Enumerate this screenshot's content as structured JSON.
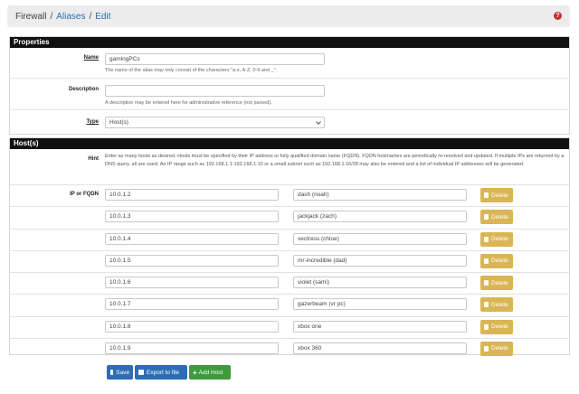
{
  "breadcrumb": {
    "root": "Firewall",
    "aliases": "Aliases",
    "current": "Edit",
    "help_icon": "?"
  },
  "properties": {
    "heading": "Properties",
    "name_label": "Name",
    "name_value": "gamingPCs",
    "name_help": "The name of the alias may only consist of the characters \"a-z, A-Z, 0-9 and _\".",
    "description_label": "Description",
    "description_value": "",
    "description_help": "A description may be entered here for administrative reference (not parsed).",
    "type_label": "Type",
    "type_value": "Host(s)"
  },
  "hosts": {
    "heading": "Host(s)",
    "hint_label": "Hint",
    "hint_text": "Enter as many hosts as desired. Hosts must be specified by their IP address or fully qualified domain name (FQDN). FQDN hostnames are periodically re-resolved and updated. If multiple IPs are returned by a DNS query, all are used. An IP range such as 192.168.1.1-192.168.1.10 or a small subnet such as 192.168.1.16/28 may also be entered and a list of individual IP addresses will be generated.",
    "ip_label": "IP or FQDN",
    "delete_label": "Delete",
    "rows": [
      {
        "ip": "10.0.1.2",
        "desc": "dash (noah)"
      },
      {
        "ip": "10.0.1.3",
        "desc": "jackjack (zach)"
      },
      {
        "ip": "10.0.1.4",
        "desc": "vectress (chloe)"
      },
      {
        "ip": "10.0.1.5",
        "desc": "mr-incredible (dad)"
      },
      {
        "ip": "10.0.1.6",
        "desc": "violet (sami)"
      },
      {
        "ip": "10.0.1.7",
        "desc": "gazerbeam (vr pc)"
      },
      {
        "ip": "10.0.1.8",
        "desc": "xbox one"
      },
      {
        "ip": "10.0.1.9",
        "desc": "xbox 360"
      }
    ]
  },
  "buttons": {
    "save": "Save",
    "export": "Export to file",
    "add_host": "Add Host"
  }
}
